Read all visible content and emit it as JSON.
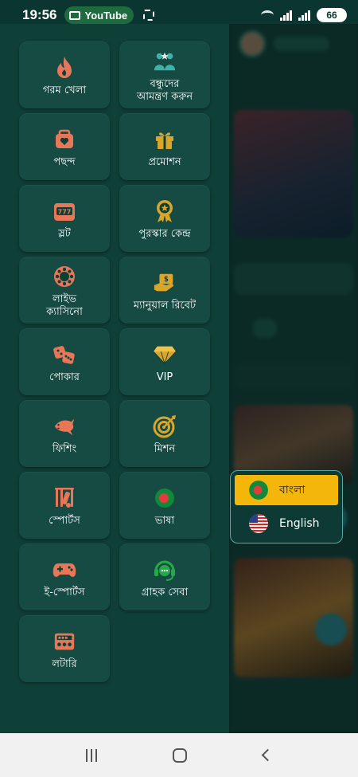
{
  "status_bar": {
    "time": "19:56",
    "app_pill": "YouTube",
    "battery": "66"
  },
  "colors": {
    "drawer_bg": "#0f4038",
    "tile_bg": "#154b43",
    "icon_orange": "#e8775a",
    "icon_gold": "#d9a52a",
    "icon_green": "#27a84a",
    "selected_lang_bg": "#f5b60c"
  },
  "menu": {
    "items": [
      {
        "label": "গরম খেলা",
        "icon": "fire-icon"
      },
      {
        "label": "বন্ধুদের\nআমন্ত্রণ করুন",
        "icon": "invite-friends-icon"
      },
      {
        "label": "পছন্দ",
        "icon": "favorite-icon"
      },
      {
        "label": "প্রমোশন",
        "icon": "gift-icon"
      },
      {
        "label": "স্লট",
        "icon": "slot-machine-icon"
      },
      {
        "label": "পুরস্কার কেন্দ্র",
        "icon": "reward-badge-icon"
      },
      {
        "label": "লাইভ\nক্যাসিনো",
        "icon": "casino-chip-icon"
      },
      {
        "label": "ম্যানুয়াল রিবেট",
        "icon": "rebate-icon"
      },
      {
        "label": "পোকার",
        "icon": "dice-icon"
      },
      {
        "label": "VIP",
        "icon": "diamond-icon"
      },
      {
        "label": "ফিশিং",
        "icon": "shark-icon"
      },
      {
        "label": "মিশন",
        "icon": "target-icon"
      },
      {
        "label": "স্পোর্টস",
        "icon": "cricket-icon"
      },
      {
        "label": "ভাষা",
        "icon": "bangladesh-flag-icon"
      },
      {
        "label": "ই-স্পোর্টস",
        "icon": "gamepad-icon"
      },
      {
        "label": "গ্রাহক সেবা",
        "icon": "headset-icon"
      },
      {
        "label": "লটারি",
        "icon": "lottery-ticket-icon"
      }
    ]
  },
  "language_popup": {
    "options": [
      {
        "label": "বাংলা",
        "flag": "bangladesh-flag",
        "selected": true
      },
      {
        "label": "English",
        "flag": "usa-flag",
        "selected": false
      }
    ]
  }
}
